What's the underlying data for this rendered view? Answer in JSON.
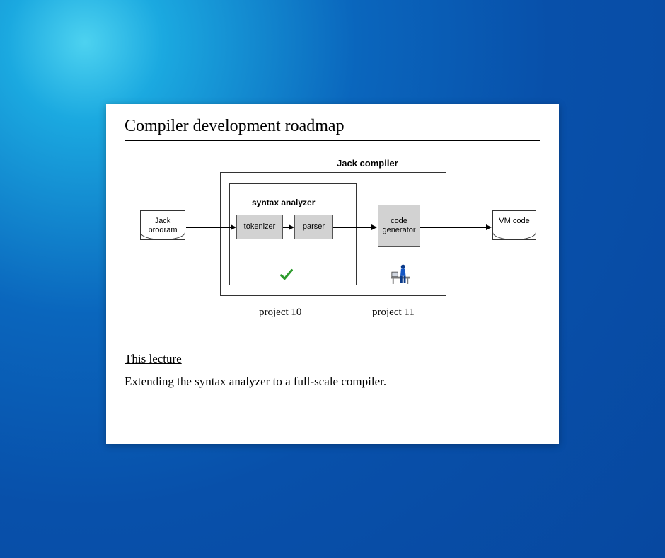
{
  "slide": {
    "title": "Compiler development roadmap",
    "lecture_heading": "This lecture",
    "lecture_body": "Extending the syntax analyzer to a full-scale compiler."
  },
  "diagram": {
    "compiler_label": "Jack compiler",
    "analyzer_label": "syntax analyzer",
    "input_doc": "Jack program",
    "output_doc": "VM code",
    "tokenizer": "tokenizer",
    "parser": "parser",
    "codegen": "code\ngenerator",
    "project10": "project 10",
    "project11": "project 11"
  },
  "icons": {
    "checkmark": "checkmark-icon",
    "person": "person-at-desk-icon"
  }
}
